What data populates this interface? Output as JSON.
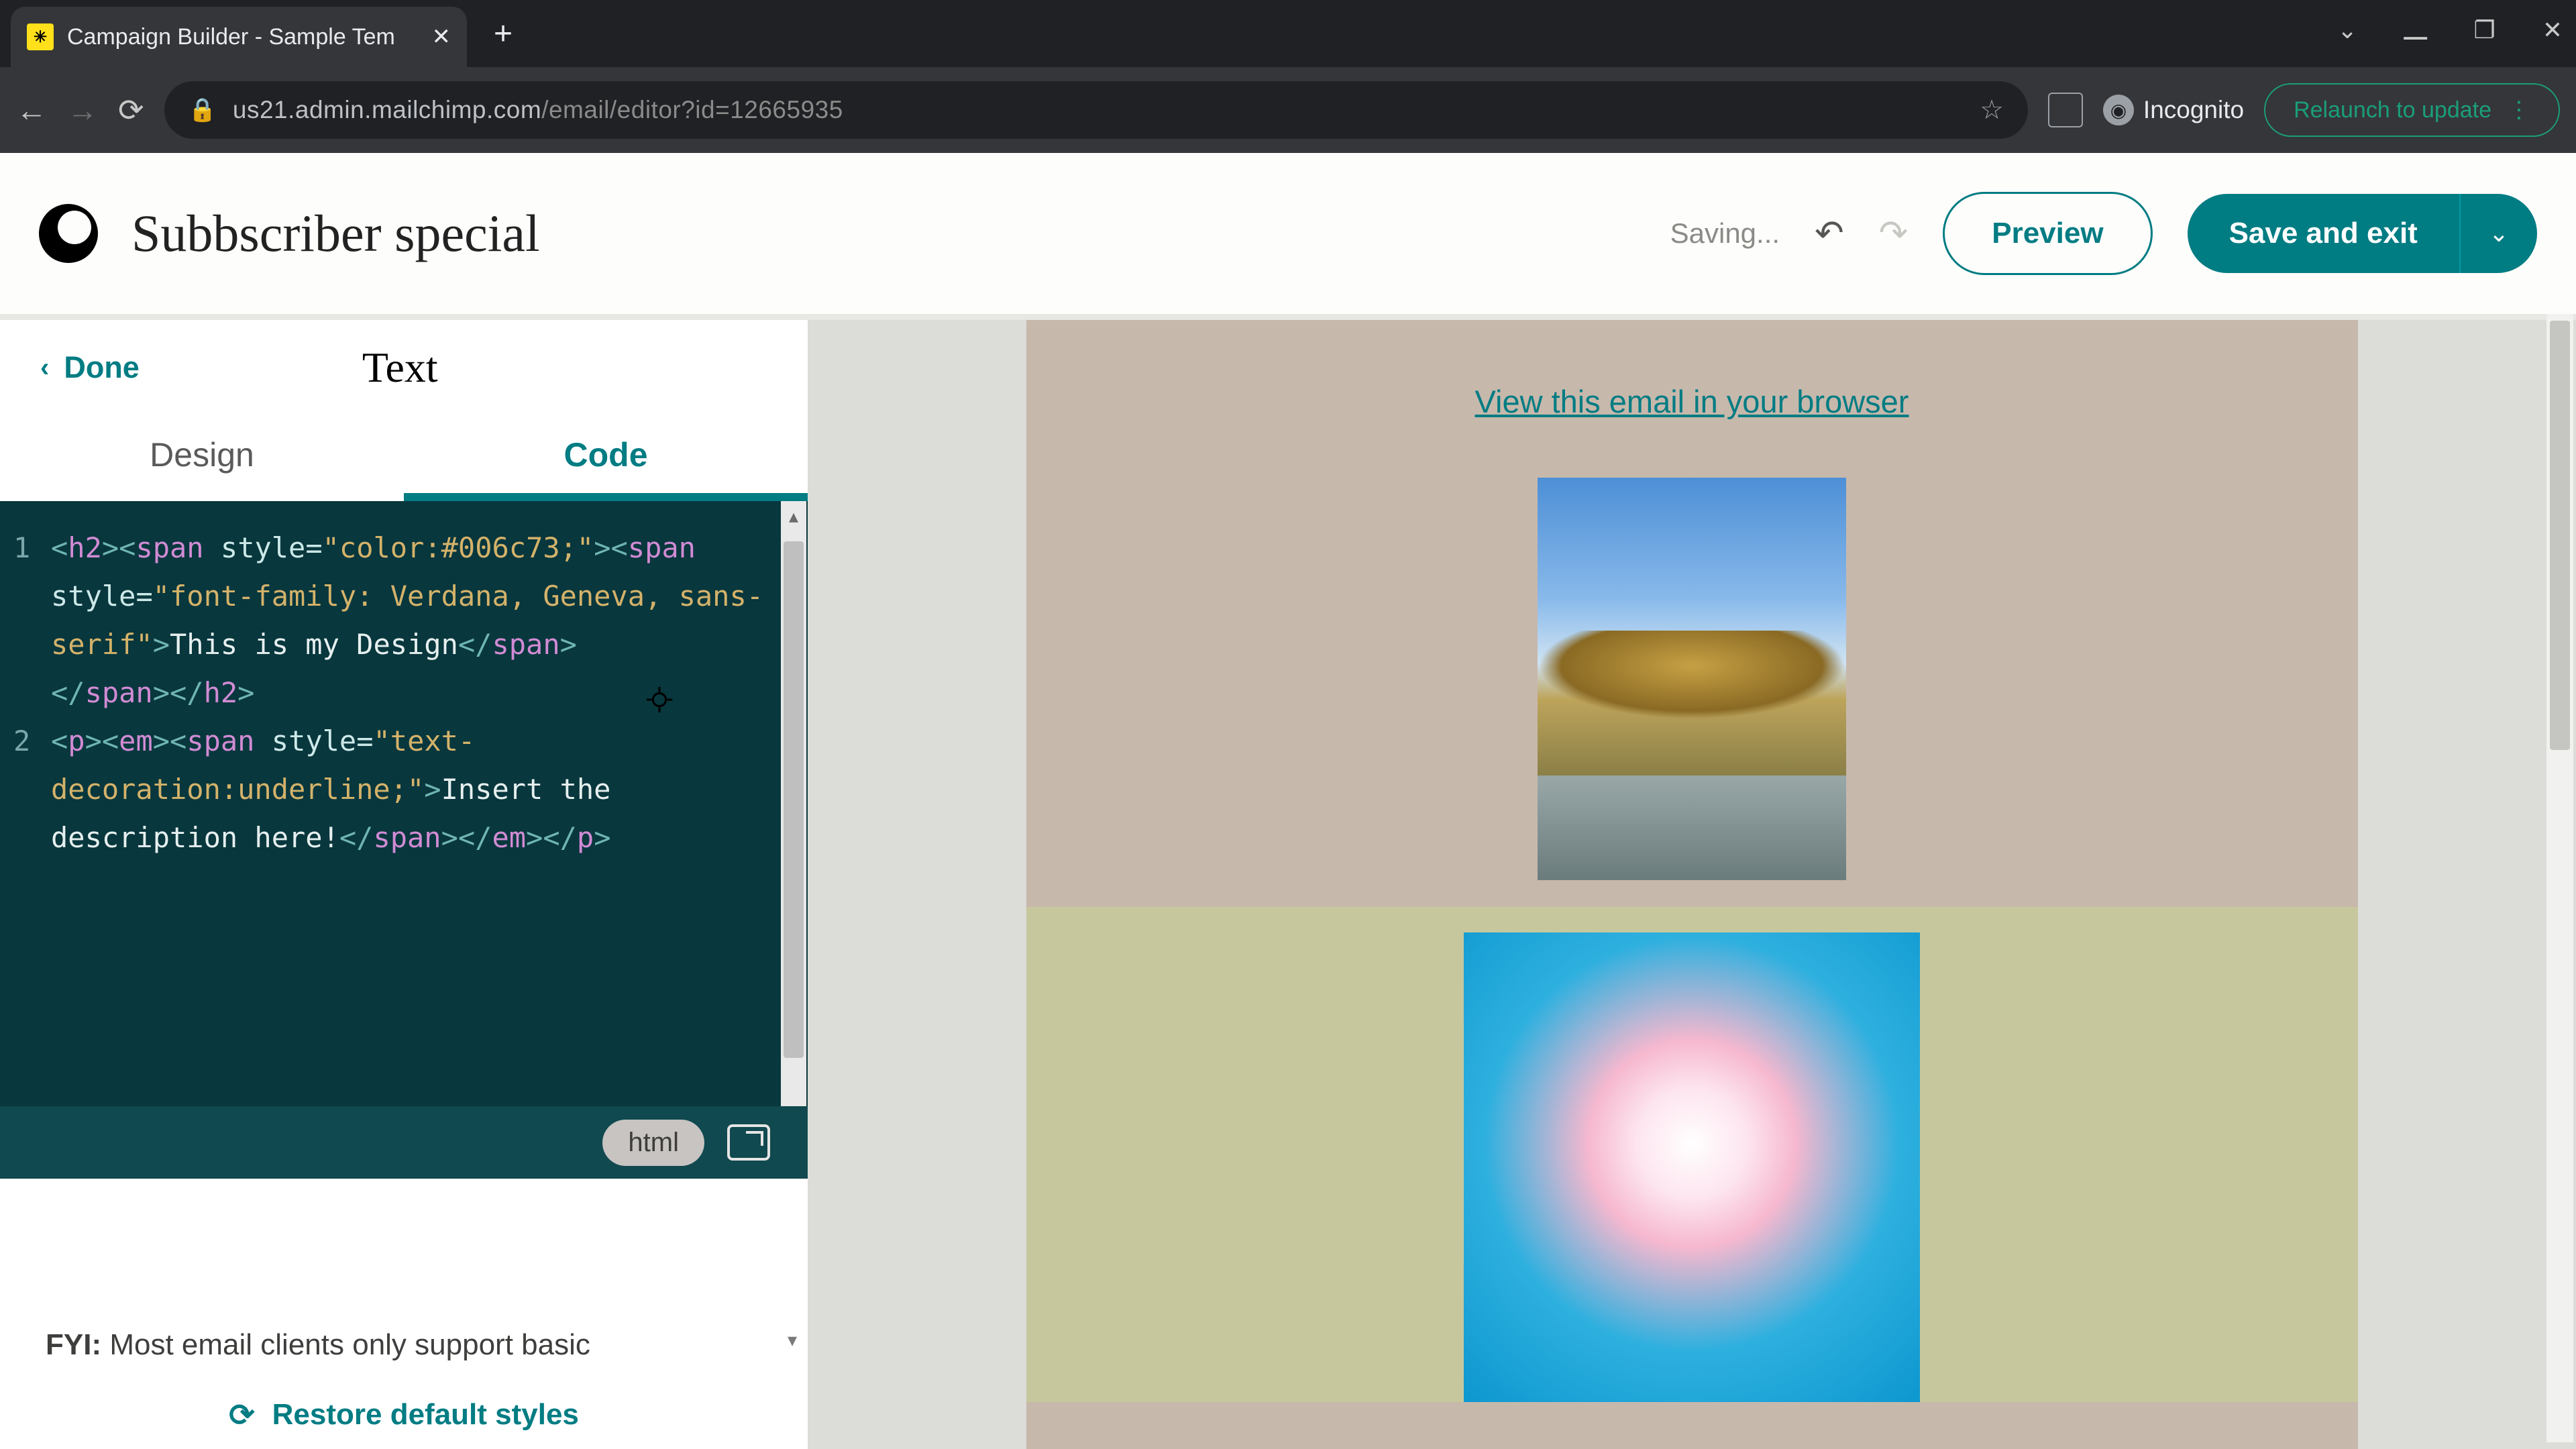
{
  "browser": {
    "tab_title": "Campaign Builder - Sample Tem",
    "url_secure_host": "us21.admin.mailchimp.com",
    "url_path": "/email/editor?id=12665935",
    "incognito_label": "Incognito",
    "relaunch_label": "Relaunch to update"
  },
  "appbar": {
    "campaign_name": "Subbscriber special",
    "status": "Saving...",
    "preview": "Preview",
    "save": "Save and exit"
  },
  "panel": {
    "done": "Done",
    "title": "Text",
    "tabs": {
      "design": "Design",
      "code": "Code"
    },
    "lang_pill": "html",
    "fyi_prefix": "FYI:",
    "fyi_text": " Most email clients only support basic",
    "restore": "Restore default styles"
  },
  "code": {
    "line1": {
      "h2o": "h2",
      "span": "span",
      "style": "style",
      "eq": "=",
      "s1": "\"color:#006c73;\"",
      "s2": "\"font-family: Verdana, Geneva, sans-serif\"",
      "text": "This is my Design"
    },
    "line2": {
      "p": "p",
      "em": "em",
      "span": "span",
      "style": "style",
      "eq": "=",
      "s1": "\"text-decoration:underline;\"",
      "text": "Insert the description here!"
    },
    "gutter": {
      "l1": "1",
      "l2": "2"
    }
  },
  "email": {
    "view_link": "View this email in your browser"
  }
}
